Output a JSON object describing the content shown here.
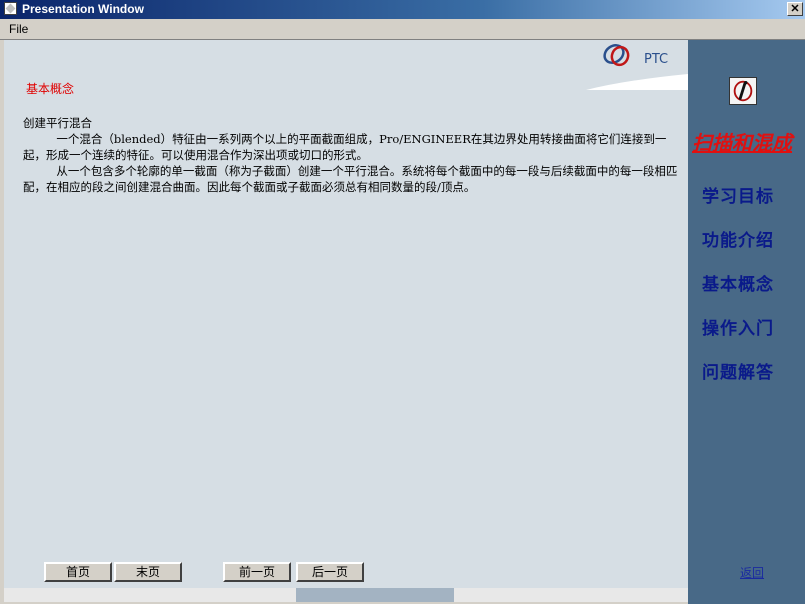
{
  "window": {
    "title": "Presentation Window"
  },
  "menu": {
    "file": "File"
  },
  "logo": {
    "text": "PTC"
  },
  "content": {
    "section_title": "基本概念",
    "subtitle": "创建平行混合",
    "paragraph1": "一个混合（blended）特征由一系列两个以上的平面截面组成，Pro/ENGINEER在其边界处用转接曲面将它们连接到一起，形成一个连续的特征。可以使用混合作为深出项或切口的形式。",
    "paragraph2": "从一个包含多个轮廓的单一截面（称为子截面）创建一个平行混合。系统将每个截面中的每一段与后续截面中的每一段相匹配，在相应的段之间创建混合曲面。因此每个截面或子截面必须总有相同数量的段/顶点。"
  },
  "buttons": {
    "first": "首页",
    "last": "末页",
    "prev": "前一页",
    "next": "后一页"
  },
  "sidebar": {
    "heading": "扫描和混成",
    "nav": [
      "学习目标",
      "功能介绍",
      "基本概念",
      "操作入门",
      "问题解答"
    ],
    "back": "返回"
  }
}
